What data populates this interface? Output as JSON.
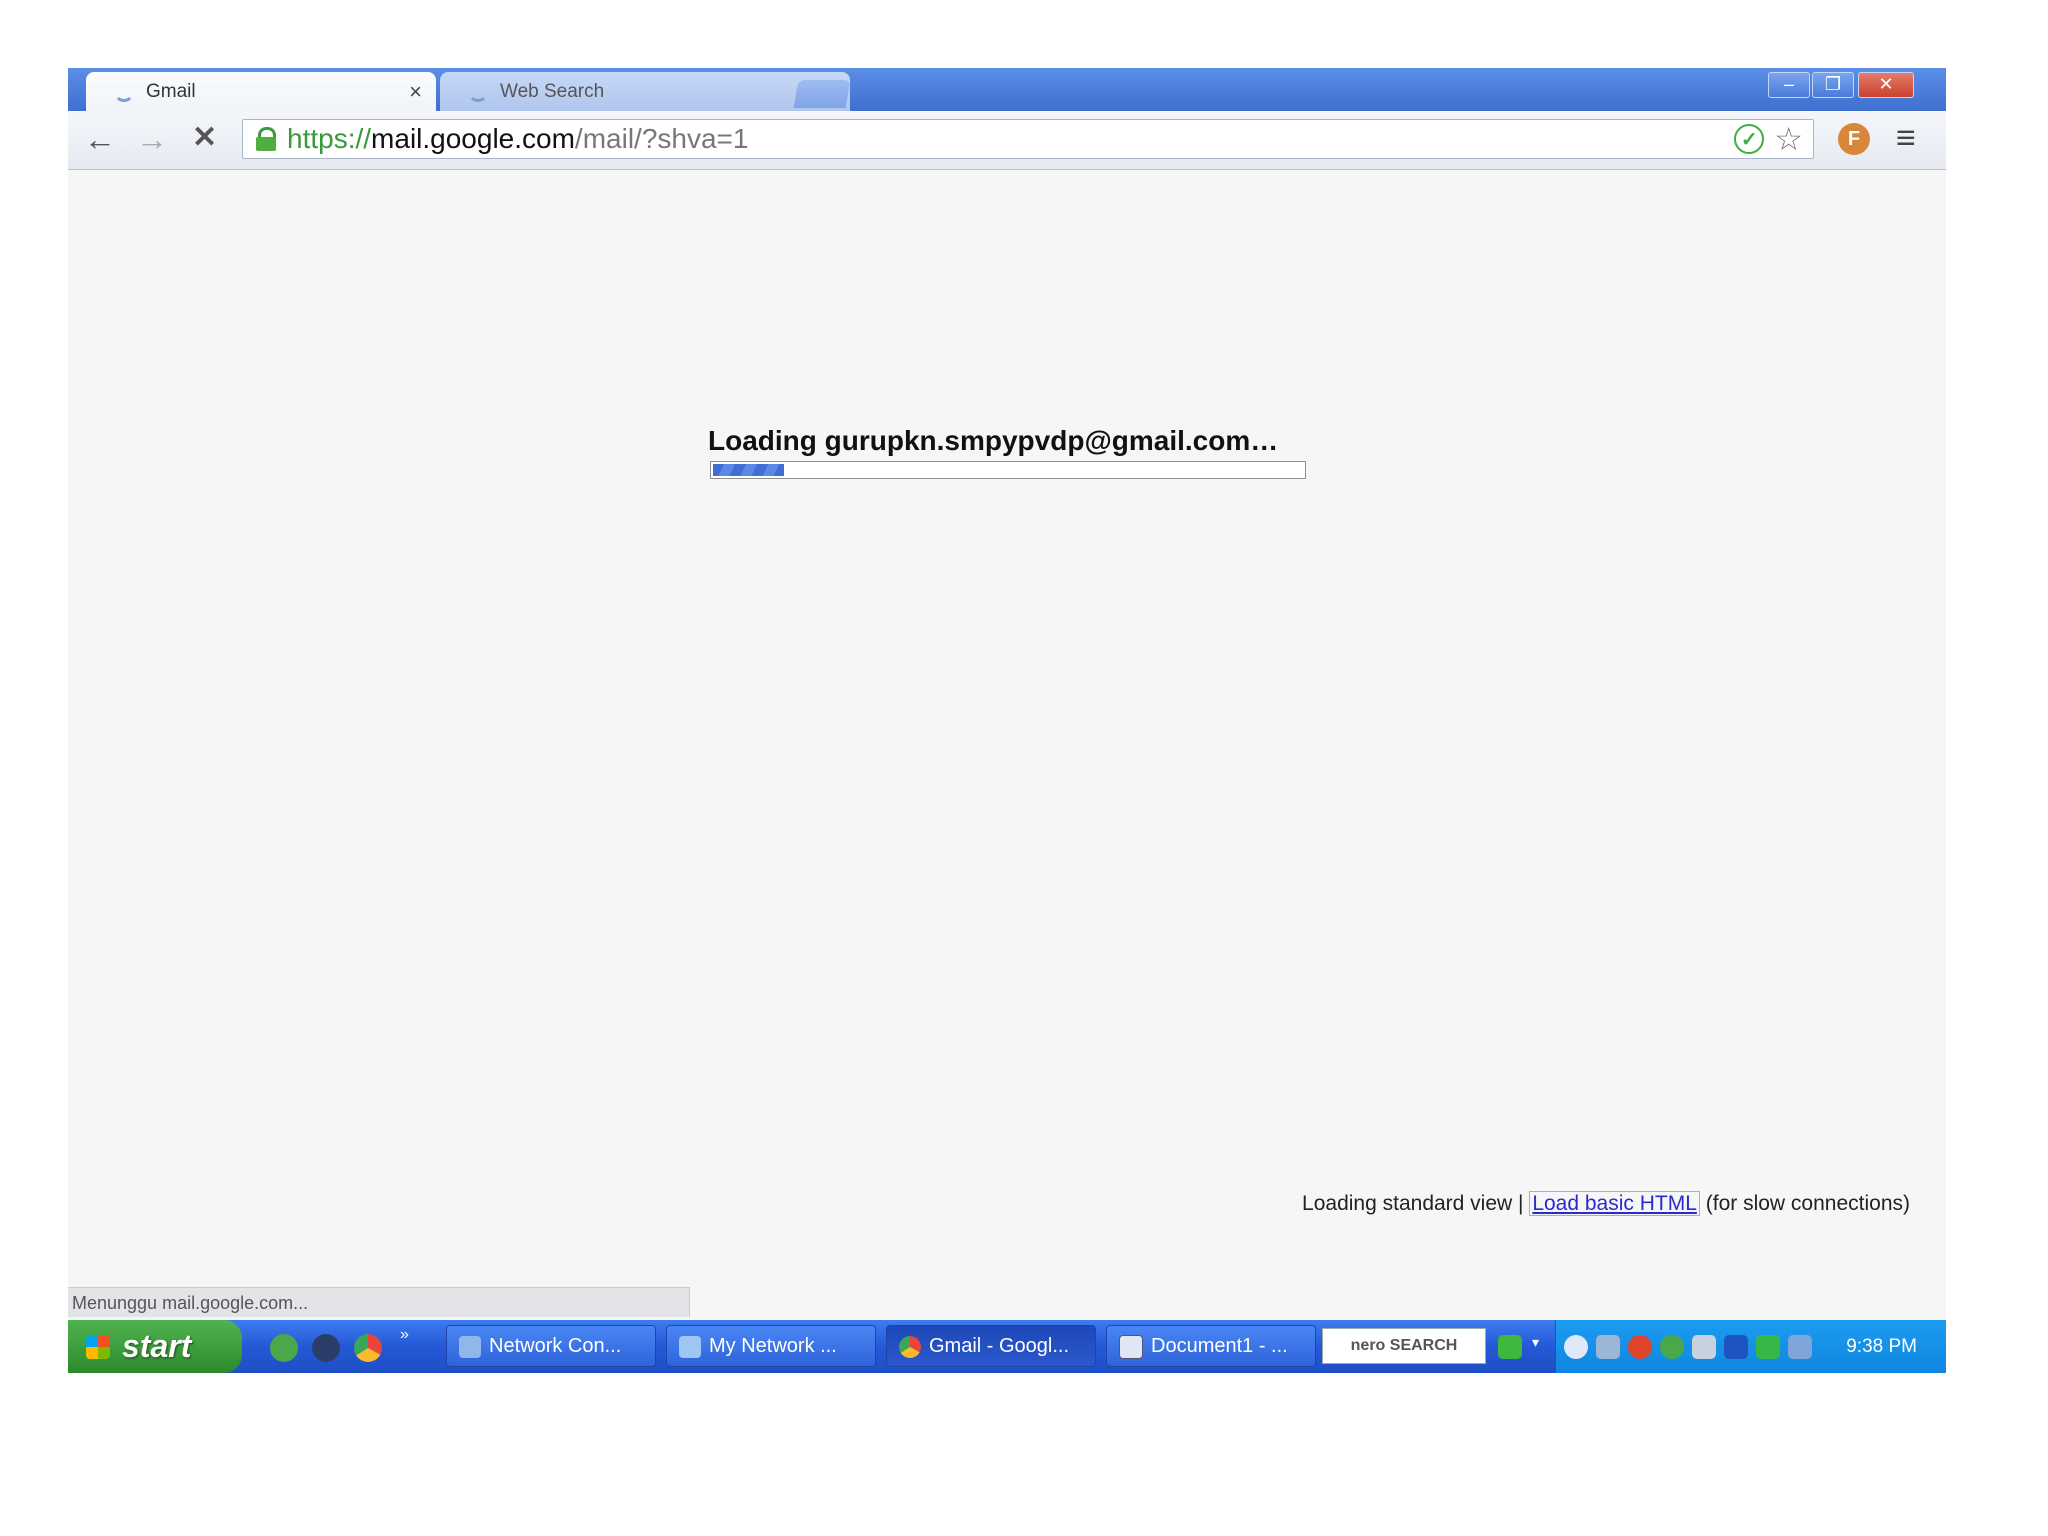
{
  "browser": {
    "tabs": [
      {
        "title": "Gmail",
        "close": "×",
        "active": true
      },
      {
        "title": "Web Search",
        "close": "×",
        "active": false
      }
    ],
    "window_controls": {
      "minimize": "–",
      "restore": "❐",
      "close": "✕"
    },
    "nav": {
      "back": "←",
      "forward": "→",
      "stop": "✕"
    },
    "url": {
      "scheme": "https://",
      "host": "mail.google.com",
      "path": "/mail/?shva=1"
    },
    "toolbar_icons": {
      "check": "✓",
      "star": "☆",
      "extension": "F",
      "menu": "≡"
    }
  },
  "page": {
    "loading_title": "Loading gurupkn.smpypvdp@gmail.com…",
    "progress_fraction": 0.12,
    "footer": {
      "prefix": "Loading standard view |",
      "link": "Load basic HTML",
      "suffix": "(for slow connections)"
    },
    "status_text": "Menunggu mail.google.com..."
  },
  "taskbar": {
    "start_label": "start",
    "quick_launch_more": "»",
    "tasks": [
      {
        "label": "Network Con...",
        "icon": "network-connections-icon"
      },
      {
        "label": "My Network ...",
        "icon": "my-network-icon"
      },
      {
        "label": "Gmail - Googl...",
        "icon": "chrome-icon",
        "active": true
      },
      {
        "label": "Document1 - ...",
        "icon": "word-document-icon"
      }
    ],
    "nero_label": "nero SEARCH",
    "clock": "9:38 PM"
  },
  "colors": {
    "accent_blue": "#3f6fd0",
    "taskbar_blue": "#2458d6",
    "start_green": "#2c8a2c",
    "secure_green": "#3a9a3a",
    "link_blue": "#2a2ad0"
  }
}
